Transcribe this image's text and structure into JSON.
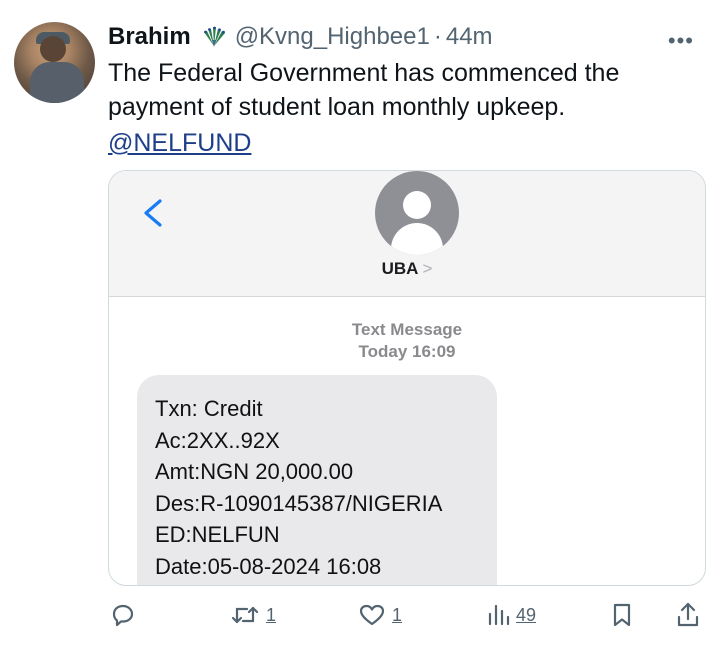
{
  "tweet": {
    "author_name": "Brahim",
    "handle": "@Kvng_Highbee1",
    "separator": "·",
    "time": "44m",
    "more_label": "•••",
    "text": "The Federal Government has commenced the payment of student loan monthly upkeep.",
    "mention": "@NELFUND"
  },
  "sms": {
    "contact_name": "UBA",
    "contact_chevron": ">",
    "header_line1": "Text Message",
    "header_line2": "Today 16:09",
    "lines": [
      "Txn: Credit",
      "Ac:2XX..92X",
      "Amt:NGN 20,000.00",
      "Des:R-1090145387/NIGERIA",
      "ED:NELFUN",
      "Date:05-08-2024 16:08"
    ]
  },
  "actions": {
    "reply": {
      "icon": "reply-icon"
    },
    "retweet": {
      "icon": "retweet-icon",
      "count": "1"
    },
    "like": {
      "icon": "heart-icon",
      "count": "1"
    },
    "views": {
      "icon": "views-icon",
      "count": "49"
    },
    "bookmark": {
      "icon": "bookmark-icon"
    },
    "share": {
      "icon": "share-icon"
    }
  },
  "colors": {
    "text": "#0f1419",
    "muted": "#536471",
    "mention": "#1d3f8a",
    "ios_blue": "#1a7cf5",
    "bubble": "#e9e9eb"
  }
}
